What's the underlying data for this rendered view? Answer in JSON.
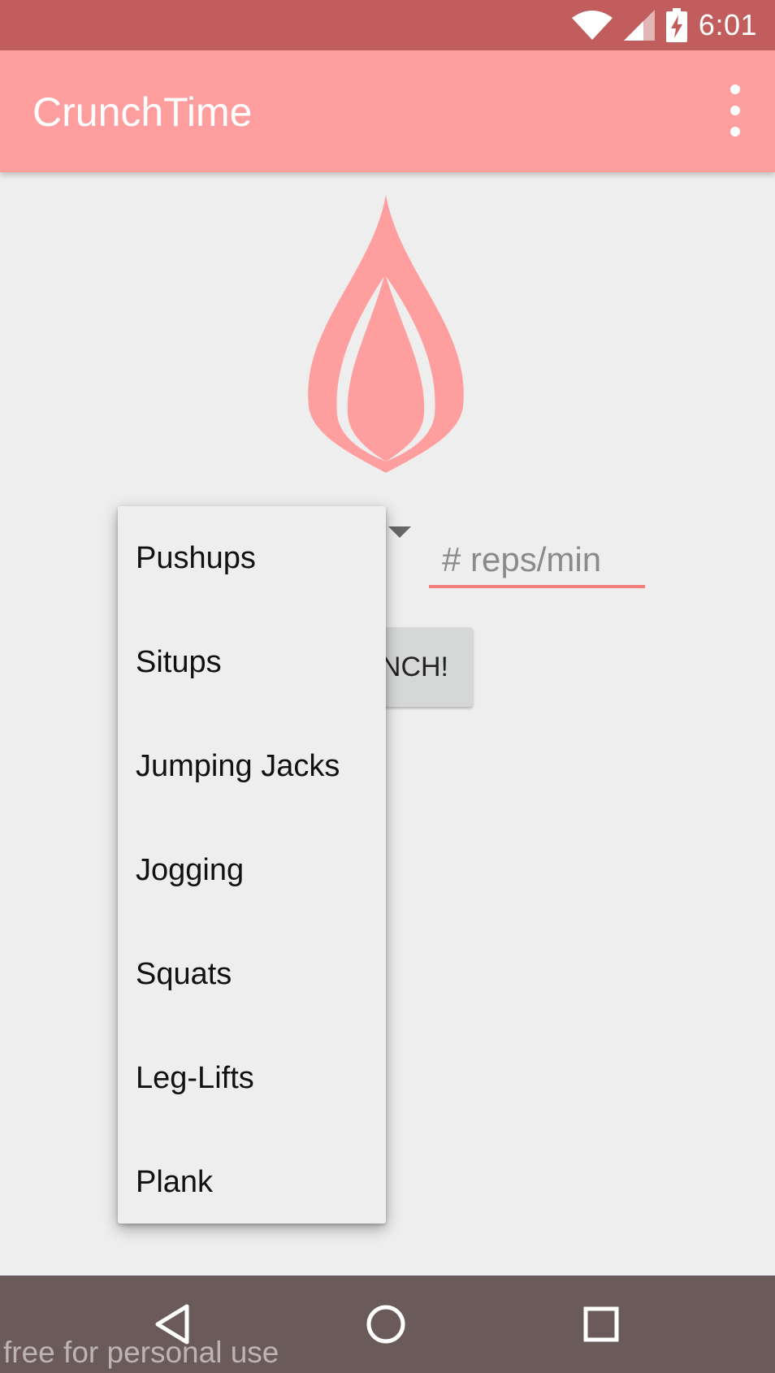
{
  "status_bar": {
    "time": "6:01",
    "icons": [
      "wifi-icon",
      "signal-icon",
      "battery-charging-icon"
    ]
  },
  "app_bar": {
    "title": "CrunchTime",
    "menu_icon": "overflow-menu-icon"
  },
  "colors": {
    "status_bar": "#c15e5d",
    "app_bar": "#ff9e9e",
    "logo": "#ff9e9e",
    "input_underline": "#f47e7b",
    "background": "#eeeeee",
    "nav_bar": "#6b5a5a"
  },
  "form": {
    "reps_placeholder": "# reps/min",
    "crunch_label": "NCH!"
  },
  "dropdown": {
    "items": [
      {
        "label": "Pushups"
      },
      {
        "label": "Situps"
      },
      {
        "label": "Jumping Jacks"
      },
      {
        "label": "Jogging"
      },
      {
        "label": "Squats"
      },
      {
        "label": "Leg-Lifts"
      },
      {
        "label": "Plank"
      }
    ]
  },
  "nav_bar": {
    "buttons": [
      "back-icon",
      "home-icon",
      "recents-icon"
    ]
  },
  "watermark": "free for personal use"
}
